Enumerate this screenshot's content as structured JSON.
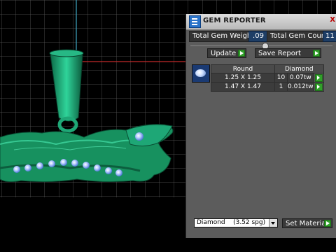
{
  "window": {
    "title": "GEM REPORTER",
    "close_glyph": "X"
  },
  "summary": {
    "total_weight_label": "Total Gem Weight",
    "total_weight_value": ".09",
    "total_count_label": "Total Gem Count",
    "total_count_value": "11"
  },
  "actions": {
    "update_label": "Update",
    "save_report_label": "Save Report"
  },
  "gem_table": {
    "shape_header": "Round",
    "material_header": "Diamond",
    "rows": [
      {
        "size": "1.25 X 1.25",
        "count": "10",
        "weight": "0.07tw"
      },
      {
        "size": "1.47 X 1.47",
        "count": "1",
        "weight": "0.012tw"
      }
    ]
  },
  "material": {
    "selected": "Diamond    (3.52 spg)",
    "set_label": "Set Material"
  },
  "icons": {
    "title_icon": "report-icon",
    "gem_thumb": "round-gem-icon",
    "arrow": "play-arrow-icon"
  },
  "colors": {
    "panel_bg": "#5c5c5c",
    "value_bg": "#1e3e66",
    "button_arrow": "#31a02a",
    "jewel_green": "#1ea776",
    "gem_blue": "#7fa6ff"
  }
}
